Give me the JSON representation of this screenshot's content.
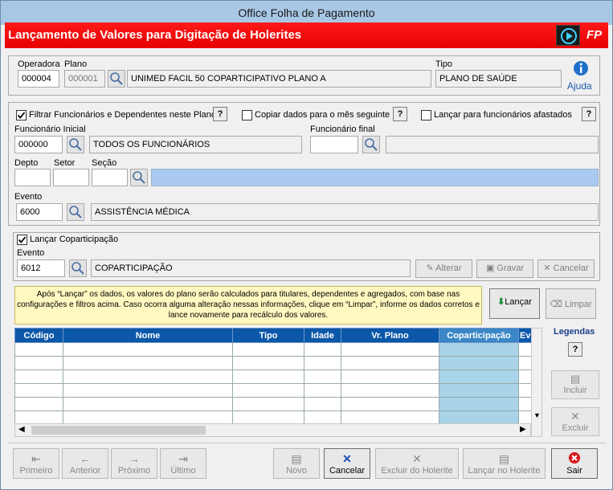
{
  "window": {
    "title": "Office Folha de Pagamento"
  },
  "header": {
    "title": "Lançamento de Valores para Digitação de Holerites",
    "logo": "FP"
  },
  "plano_section": {
    "operadora_label": "Operadora",
    "operadora_value": "000004",
    "plano_label": "Plano",
    "plano_code": "000001",
    "plano_name": "UNIMED FACIL 50 COPARTICIPATIVO PLANO A",
    "tipo_label": "Tipo",
    "tipo_value": "PLANO DE SAÚDE",
    "help_label": "Ajuda"
  },
  "filters": {
    "filtrar_label": "Filtrar Funcionários e Dependentes neste Plano",
    "filtrar_checked": true,
    "copiar_label": "Copiar dados para o mês seguinte",
    "copiar_checked": false,
    "afastados_label": "Lançar para funcionários afastados",
    "afastados_checked": false,
    "help_q": "?",
    "func_inicial_label": "Funcionário Inicial",
    "func_inicial_value": "000000",
    "func_inicial_name": "TODOS OS FUNCIONÁRIOS",
    "func_final_label": "Funcionário final",
    "func_final_value": "",
    "depto_label": "Depto",
    "setor_label": "Setor",
    "secao_label": "Seção",
    "evento_label": "Evento",
    "evento_value": "6000",
    "evento_name": "ASSISTÊNCIA MÉDICA"
  },
  "coparticipacao": {
    "checkbox_label": "Lançar Coparticipação",
    "checked": true,
    "evento_label": "Evento",
    "evento_value": "6012",
    "evento_name": "COPARTICIPAÇÃO",
    "alterar": "Alterar",
    "gravar": "Gravar",
    "cancelar": "Cancelar"
  },
  "note": "Após “Lançar” os dados, os valores do plano serão calculados para titulares, dependentes e agregados, com base nas configurações e filtros acima. Caso ocorra alguma alteração nessas informações, clique em “Limpar”,  informe os dados corretos e lance novamente para recálculo dos valores.",
  "actions": {
    "lancar": "Lançar",
    "limpar": "Limpar"
  },
  "grid": {
    "columns": [
      "Código",
      "Nome",
      "Tipo",
      "Idade",
      "Vr. Plano",
      "Coparticipação",
      "Ev"
    ],
    "rows": 6
  },
  "legend": {
    "title": "Legendas",
    "q": "?",
    "incluir": "Incluir",
    "excluir": "Excluir"
  },
  "footer": {
    "primeiro": "Primeiro",
    "anterior": "Anterior",
    "proximo": "Próximo",
    "ultimo": "Último",
    "novo": "Novo",
    "cancelar": "Cancelar",
    "excluir_holerite": "Excluir do Holerite",
    "lancar_holerite": "Lançar no Holerite",
    "sair": "Sair"
  },
  "colors": {
    "accent_red": "#e60000",
    "grid_header": "#0b57a8",
    "copart_col": "#a8d3e8",
    "note_bg": "#fff8c0"
  }
}
